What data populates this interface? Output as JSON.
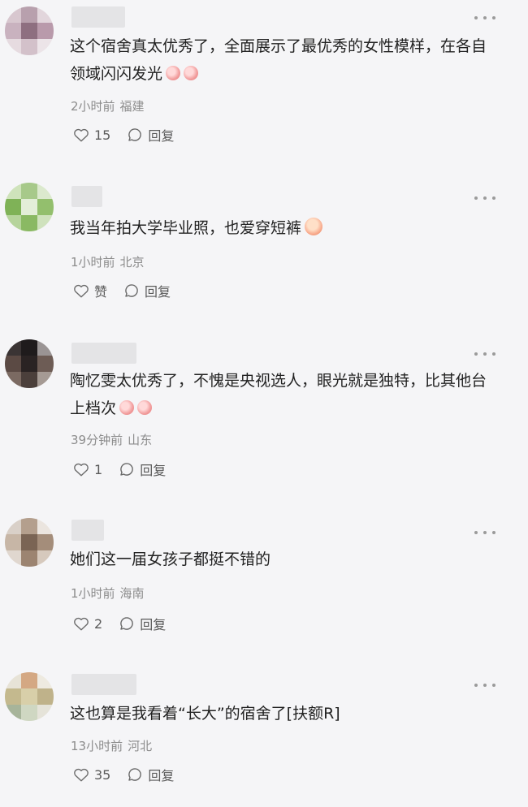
{
  "comments": [
    {
      "text": "这个宿舍真太优秀了，全面展示了最优秀的女性模样，在各自领域闪闪发光",
      "emoji": "thumbs-up-emoji-x2",
      "time": "2小时前",
      "location": "福建",
      "like_label": "15",
      "reply_label": "回复"
    },
    {
      "text": "我当年拍大学毕业照，也爱穿短裤",
      "emoji": "blush-face-emoji",
      "time": "1小时前",
      "location": "北京",
      "like_label": "赞",
      "reply_label": "回复"
    },
    {
      "text": "陶忆雯太优秀了，不愧是央视选人，眼光就是独特，比其他台上档次",
      "emoji": "thumbs-up-emoji-x2",
      "time": "39分钟前",
      "location": "山东",
      "like_label": "1",
      "reply_label": "回复"
    },
    {
      "text": "她们这一届女孩子都挺不错的",
      "time": "1小时前",
      "location": "海南",
      "like_label": "2",
      "reply_label": "回复"
    },
    {
      "text": "这也算是我看着“长大”的宿舍了[扶额R]",
      "time": "13小时前",
      "location": "河北",
      "like_label": "35",
      "reply_label": "回复"
    }
  ],
  "icons": {
    "like": "heart-outline-icon",
    "reply": "speech-bubble-icon",
    "more": "more-dots-icon"
  },
  "colors": {
    "background": "#f5f5f7",
    "text": "#222222",
    "meta": "#8c8c8c",
    "action": "#5a5a5a"
  }
}
